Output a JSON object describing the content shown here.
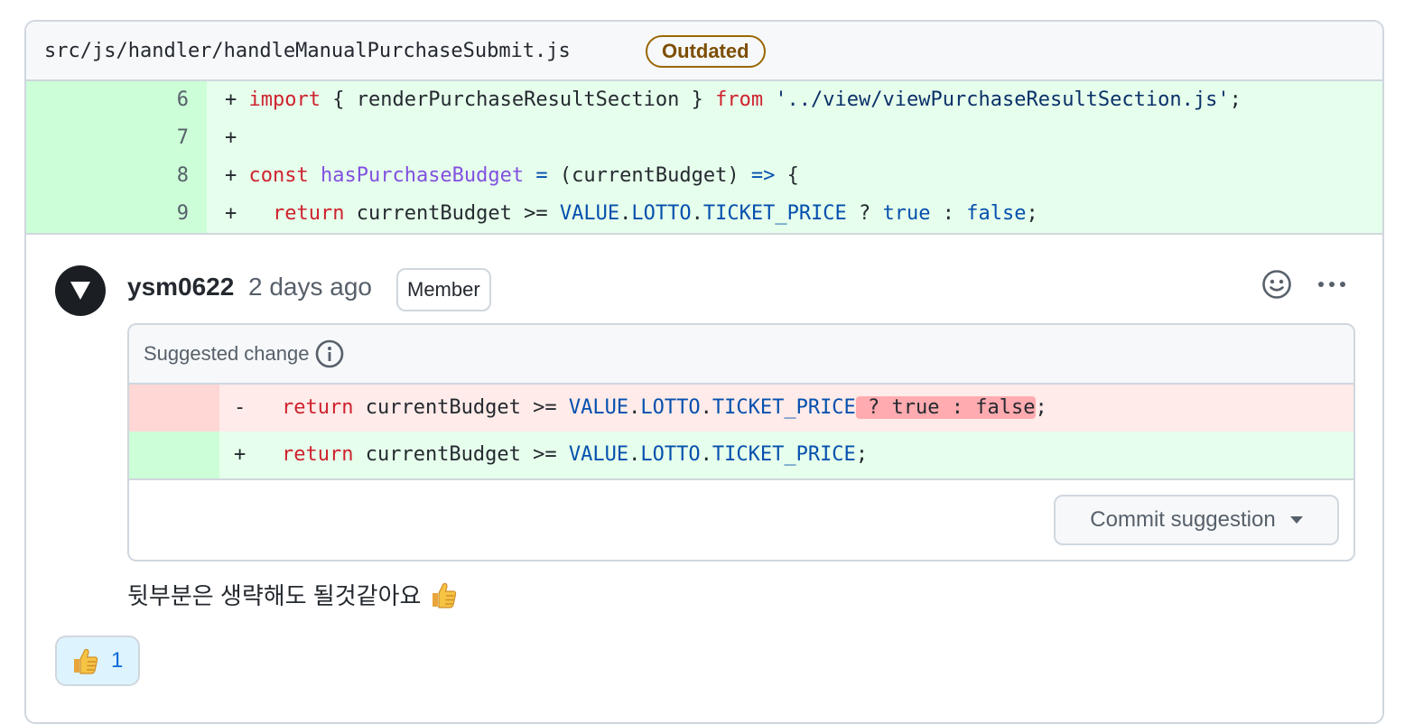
{
  "file": {
    "path": "src/js/handler/handleManualPurchaseSubmit.js",
    "badge": "Outdated"
  },
  "code_lines": [
    {
      "num": "6",
      "prefix": "+ ",
      "t1": "import",
      "t2": " { renderPurchaseResultSection } ",
      "t3": "from",
      "t4": " ",
      "t5": "'../view/viewPurchaseResultSection.js'",
      "t6": ";"
    },
    {
      "num": "7",
      "prefix": "+"
    },
    {
      "num": "8",
      "prefix": "+ ",
      "t1": "const",
      "t2": " ",
      "t3": "hasPurchaseBudget",
      "t4": " ",
      "t5": "=",
      "t6": " (currentBudget) ",
      "t7": "=>",
      "t8": " {"
    },
    {
      "num": "9",
      "prefix": "+   ",
      "t1": "return",
      "t2": " currentBudget >= ",
      "t3": "VALUE",
      "t4": ".",
      "t5": "LOTTO",
      "t6": ".",
      "t7": "TICKET_PRICE",
      "t8": " ? ",
      "t9": "true",
      "t10": " : ",
      "t11": "false",
      "t12": ";"
    }
  ],
  "comment": {
    "author": "ysm0622",
    "time": "2 days ago",
    "role_badge": "Member",
    "body": "뒷부분은 생략해도 될것같아요"
  },
  "suggestion": {
    "title": "Suggested change",
    "del": {
      "prefix": "-   ",
      "t1": "return",
      "t2": " currentBudget >= ",
      "t3": "VALUE",
      "t4": ".",
      "t5": "LOTTO",
      "t6": ".",
      "t7": "TICKET_PRICE",
      "t8": " ? true : false",
      "t9": ";"
    },
    "add": {
      "prefix": "+   ",
      "t1": "return",
      "t2": " currentBudget >= ",
      "t3": "VALUE",
      "t4": ".",
      "t5": "LOTTO",
      "t6": ".",
      "t7": "TICKET_PRICE",
      "t8": ";"
    },
    "commit_label": "Commit suggestion"
  },
  "reaction": {
    "emoji": "thumbs-up-icon",
    "count": "1"
  },
  "icons": {
    "avatar": "triangle-down-icon",
    "add_reaction": "smiley-icon",
    "more": "kebab-horizontal-icon",
    "info": "info-icon",
    "dropdown": "triangle-down-icon",
    "comment_emoji": "thumbs-up-icon"
  },
  "colors": {
    "added_bg": "#e6ffec",
    "added_gutter": "#ccffd8",
    "deleted_bg": "#ffebe9",
    "deleted_gutter": "#ffd7d5",
    "deleted_highlight": "#ffabb0",
    "outdated_border": "#9a6700",
    "keyword": "#cf222e",
    "function": "#8250df",
    "constant": "#0550ae",
    "string": "#0a3069",
    "link": "#0969da"
  }
}
